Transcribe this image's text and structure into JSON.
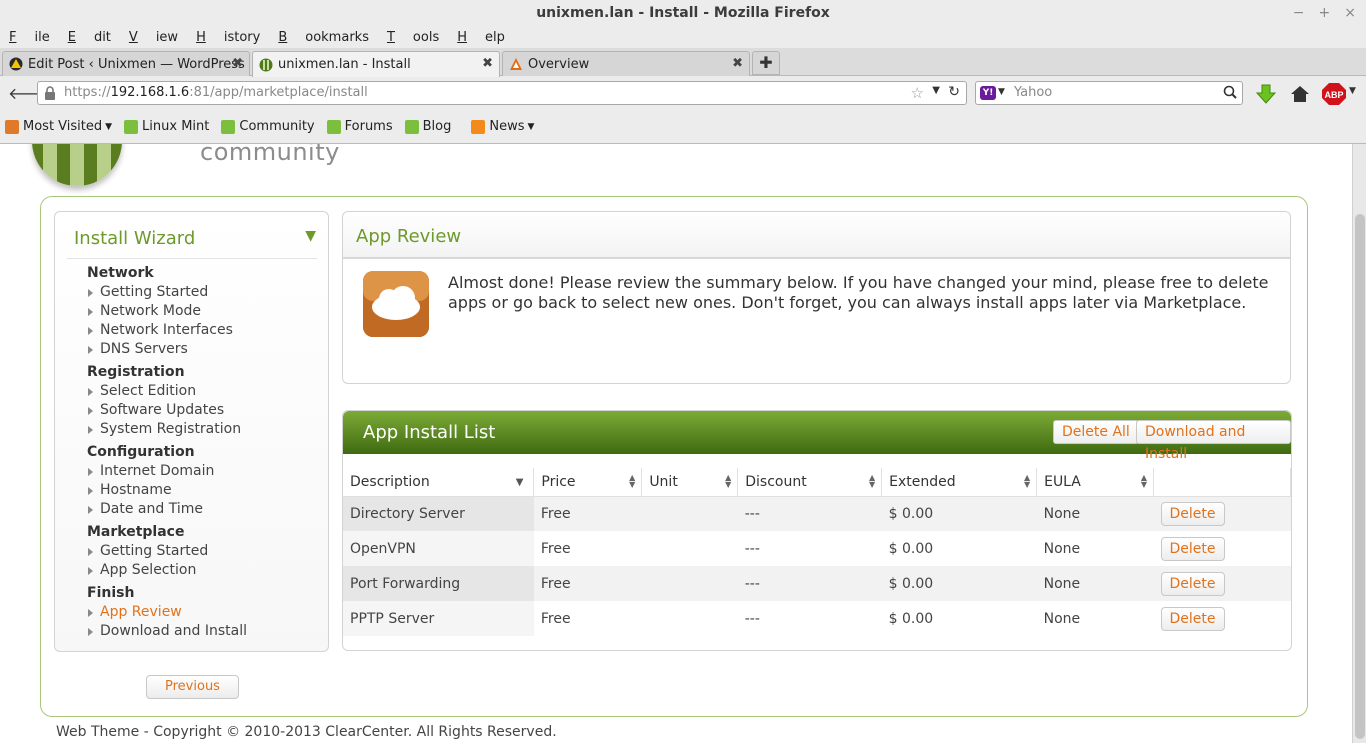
{
  "window": {
    "title": "unixmen.lan - Install - Mozilla Firefox",
    "controls": [
      "−",
      "+",
      "×"
    ]
  },
  "menu": [
    "File",
    "Edit",
    "View",
    "History",
    "Bookmarks",
    "Tools",
    "Help"
  ],
  "menu_underline": [
    "F",
    "E",
    "V",
    "H",
    "B",
    "T",
    "H"
  ],
  "tabs": [
    {
      "label": "Edit Post ‹ Unixmen — WordPress"
    },
    {
      "label": "unixmen.lan - Install"
    },
    {
      "label": "Overview"
    }
  ],
  "address": {
    "prefix": "https://",
    "host": "192.168.1.6",
    "rest": ":81/app/marketplace/install"
  },
  "search": {
    "placeholder": "Yahoo",
    "engine": "Y!"
  },
  "bookmarks": [
    {
      "label": "Most Visited",
      "dropdown": true
    },
    {
      "label": "Linux Mint"
    },
    {
      "label": "Community"
    },
    {
      "label": "Forums"
    },
    {
      "label": "Blog"
    },
    {
      "label": "News",
      "dropdown": true
    }
  ],
  "logo_text": "community",
  "wizard": {
    "title": "Install Wizard",
    "groups": [
      {
        "name": "Network",
        "items": [
          "Getting Started",
          "Network Mode",
          "Network Interfaces",
          "DNS Servers"
        ]
      },
      {
        "name": "Registration",
        "items": [
          "Select Edition",
          "Software Updates",
          "System Registration"
        ]
      },
      {
        "name": "Configuration",
        "items": [
          "Internet Domain",
          "Hostname",
          "Date and Time"
        ]
      },
      {
        "name": "Marketplace",
        "items": [
          "Getting Started",
          "App Selection"
        ]
      },
      {
        "name": "Finish",
        "items": [
          "App Review",
          "Download and Install"
        ]
      }
    ],
    "active_item": "App Review"
  },
  "previous_label": "Previous",
  "review": {
    "title": "App Review",
    "text": "Almost done! Please review the summary below. If you have changed your mind, please free to delete apps or go back to select new ones. Don't forget, you can always install apps later via Marketplace."
  },
  "install_list": {
    "title": "App Install List",
    "delete_all": "Delete All",
    "download_install": "Download and Install",
    "columns": [
      "Description",
      "Price",
      "Unit",
      "Discount",
      "Extended",
      "EULA",
      ""
    ],
    "rows": [
      {
        "description": "Directory Server",
        "price": "Free",
        "unit": "",
        "discount": "---",
        "extended": "$ 0.00",
        "eula": "None",
        "action": "Delete"
      },
      {
        "description": "OpenVPN",
        "price": "Free",
        "unit": "",
        "discount": "---",
        "extended": "$ 0.00",
        "eula": "None",
        "action": "Delete"
      },
      {
        "description": "Port Forwarding",
        "price": "Free",
        "unit": "",
        "discount": "---",
        "extended": "$ 0.00",
        "eula": "None",
        "action": "Delete"
      },
      {
        "description": "PPTP Server",
        "price": "Free",
        "unit": "",
        "discount": "---",
        "extended": "$ 0.00",
        "eula": "None",
        "action": "Delete"
      }
    ]
  },
  "footer": "Web Theme - Copyright © 2010-2013 ClearCenter. All Rights Reserved.",
  "colors": {
    "accent_green": "#6d9a2a",
    "header_green_dark": "#3f6a11",
    "link_orange": "#e1721c"
  }
}
